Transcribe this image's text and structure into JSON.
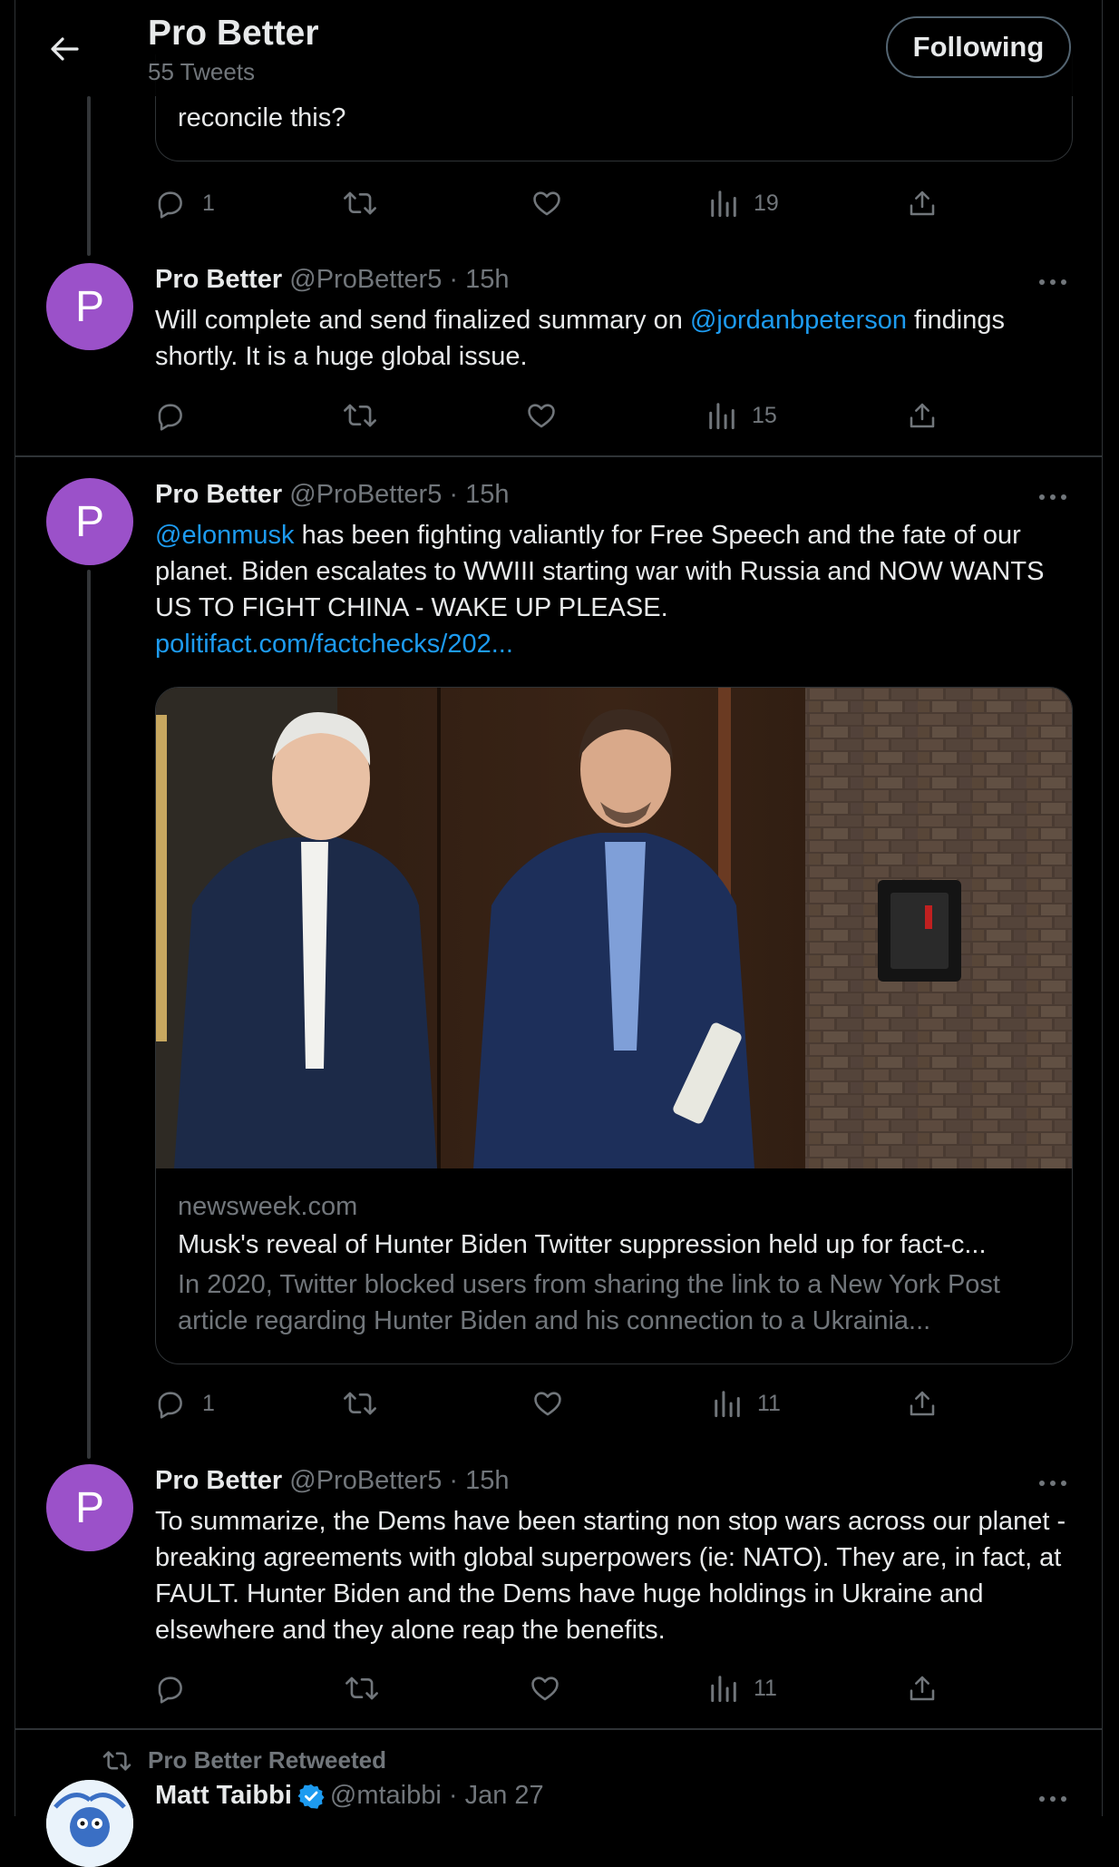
{
  "header": {
    "title": "Pro Better",
    "subtitle": "55 Tweets",
    "follow_label": "Following"
  },
  "quote_tail": {
    "text": "reconcile this?",
    "stats": {
      "replies": "1",
      "retweets": "",
      "likes": "",
      "views": "19"
    }
  },
  "tweets": [
    {
      "name": "Pro Better",
      "handle": "@ProBetter5",
      "time": "· 15h",
      "avatar_letter": "P",
      "text_before": "Will complete and send finalized summary on ",
      "mention": "@jordanbpeterson",
      "text_after": " findings shortly.  It is a huge global issue.",
      "stats": {
        "replies": "",
        "retweets": "",
        "likes": "",
        "views": "15"
      }
    },
    {
      "name": "Pro Better",
      "handle": "@ProBetter5",
      "time": "· 15h",
      "avatar_letter": "P",
      "mention": "@elonmusk",
      "text_after": " has been fighting valiantly for Free Speech and the fate of our planet. Biden escalates to WWIII starting war with Russia and NOW WANTS US TO FIGHT CHINA - WAKE UP PLEASE.",
      "link": "politifact.com/factchecks/202...",
      "card": {
        "domain": "newsweek.com",
        "title": "Musk's reveal of Hunter Biden Twitter suppression held up for fact-c...",
        "description": "In 2020, Twitter blocked users from sharing the link to a New York Post article regarding Hunter Biden and his connection to a Ukrainia..."
      },
      "stats": {
        "replies": "1",
        "retweets": "",
        "likes": "",
        "views": "11"
      }
    },
    {
      "name": "Pro Better",
      "handle": "@ProBetter5",
      "time": "· 15h",
      "avatar_letter": "P",
      "text": "To summarize, the Dems have been starting non stop wars across our planet - breaking agreements with global superpowers (ie: NATO).  They are, in fact, at FAULT.  Hunter Biden and the Dems have huge holdings in Ukraine and elsewhere and they alone reap the benefits.",
      "stats": {
        "replies": "",
        "retweets": "",
        "likes": "",
        "views": "11"
      }
    }
  ],
  "retweet": {
    "label": "Pro Better Retweeted",
    "name": "Matt Taibbi",
    "handle": "@mtaibbi",
    "time": "· Jan 27"
  },
  "colors": {
    "background": "#000000",
    "text": "#e7e9ea",
    "muted": "#71767b",
    "link": "#1d9bf0",
    "avatar": "#9b51c9",
    "border": "#2f3336",
    "verified": "#1d9bf0"
  },
  "icons": [
    "back-arrow-icon",
    "reply-icon",
    "retweet-icon",
    "like-icon",
    "views-icon",
    "share-icon",
    "more-icon",
    "verified-badge-icon"
  ]
}
